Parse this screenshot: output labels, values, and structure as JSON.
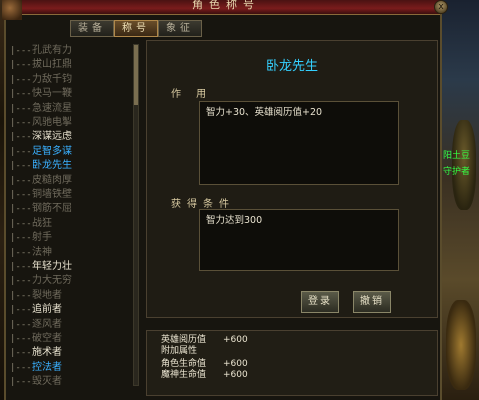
{
  "window": {
    "title": "角色称号",
    "close": "x"
  },
  "tabs": [
    {
      "label": "装备",
      "active": false
    },
    {
      "label": "称号",
      "active": true
    },
    {
      "label": "象征",
      "active": false
    }
  ],
  "titles_list": [
    {
      "label": "孔武有力",
      "color": "#6f6a5c"
    },
    {
      "label": "拔山扛鼎",
      "color": "#6f6a5c"
    },
    {
      "label": "力敌千钧",
      "color": "#6f6a5c"
    },
    {
      "label": "快马一鞭",
      "color": "#6f6a5c"
    },
    {
      "label": "急速流星",
      "color": "#6f6a5c"
    },
    {
      "label": "风驰电掣",
      "color": "#6f6a5c"
    },
    {
      "label": "深谋远虑",
      "color": "#e8e2cf"
    },
    {
      "label": "足智多谋",
      "color": "#3ab0ff"
    },
    {
      "label": "卧龙先生",
      "color": "#3ab0ff",
      "selected": true
    },
    {
      "label": "皮糙肉厚",
      "color": "#6f6a5c"
    },
    {
      "label": "铜墙铁壁",
      "color": "#6f6a5c"
    },
    {
      "label": "钢筋不屈",
      "color": "#6f6a5c"
    },
    {
      "label": "战狂",
      "color": "#6f6a5c"
    },
    {
      "label": "射手",
      "color": "#6f6a5c"
    },
    {
      "label": "法神",
      "color": "#6f6a5c"
    },
    {
      "label": "年轻力壮",
      "color": "#e8e2cf"
    },
    {
      "label": "力大无穷",
      "color": "#6f6a5c"
    },
    {
      "label": "裂地者",
      "color": "#6f6a5c"
    },
    {
      "label": "追前者",
      "color": "#e8e2cf"
    },
    {
      "label": "逐风者",
      "color": "#6f6a5c"
    },
    {
      "label": "破空者",
      "color": "#6f6a5c"
    },
    {
      "label": "施术者",
      "color": "#e8e2cf"
    },
    {
      "label": "控法者",
      "color": "#3ab0ff"
    },
    {
      "label": "毁灭者",
      "color": "#6f6a5c"
    }
  ],
  "detail": {
    "title": "卧龙先生",
    "effect_label": "作 用",
    "effect_text": "智力+30、英雄阅历值+20",
    "condition_label": "获得条件",
    "condition_text": "智力达到300",
    "equip_button": "登录",
    "cancel_button": "撤销"
  },
  "stats": [
    {
      "name": "英雄阅历值",
      "value": "+600"
    },
    {
      "name": "附加属性",
      "value": ""
    },
    {
      "name": "角色生命值",
      "value": "+600"
    },
    {
      "name": "魔神生命值",
      "value": "+600"
    }
  ],
  "npc": {
    "line1": "阳土豆",
    "line2": "守护者"
  }
}
